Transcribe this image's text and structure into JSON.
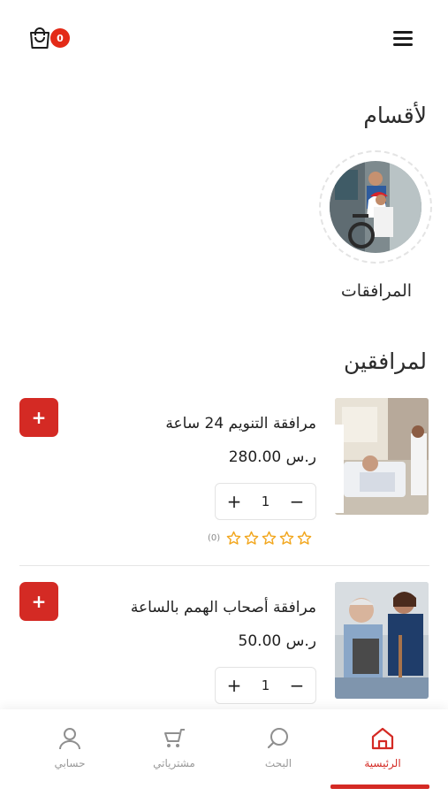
{
  "header": {
    "cart_count": "0"
  },
  "categories": {
    "title": "لأقسام",
    "items": [
      {
        "label": "المرافقات"
      }
    ]
  },
  "products": {
    "title": "لمرافقين",
    "items": [
      {
        "name": "مرافقة التنويم 24 ساعة",
        "price": "ر.س 280.00",
        "quantity": "1",
        "rating": 0,
        "rating_count": "(0)",
        "add_label": "+"
      },
      {
        "name": "مرافقة أصحاب الهمم بالساعة",
        "price": "ر.س 50.00",
        "quantity": "1",
        "add_label": "+"
      }
    ]
  },
  "bottom_nav": {
    "home": "الرئيسية",
    "search": "البحث",
    "orders": "مشترياتي",
    "account": "حسابي"
  },
  "colors": {
    "accent": "#d42a24",
    "badge": "#e32a17",
    "star": "#f2a61c"
  }
}
